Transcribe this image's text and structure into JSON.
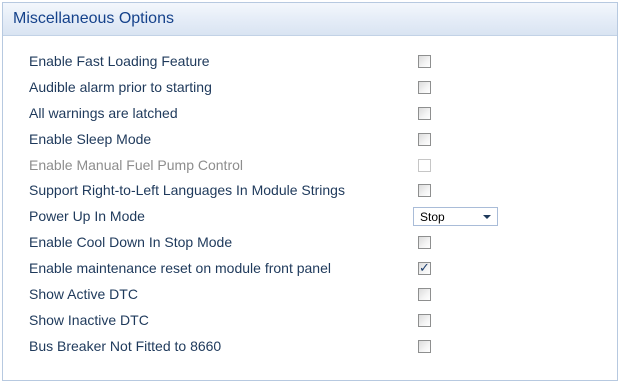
{
  "panel": {
    "title": "Miscellaneous Options"
  },
  "options": [
    {
      "label": "Enable Fast Loading Feature",
      "control": "checkbox",
      "checked": false,
      "enabled": true
    },
    {
      "label": "Audible alarm prior to starting",
      "control": "checkbox",
      "checked": false,
      "enabled": true
    },
    {
      "label": "All warnings are latched",
      "control": "checkbox",
      "checked": false,
      "enabled": true
    },
    {
      "label": "Enable Sleep Mode",
      "control": "checkbox",
      "checked": false,
      "enabled": true
    },
    {
      "label": "Enable Manual Fuel Pump Control",
      "control": "checkbox",
      "checked": false,
      "enabled": false
    },
    {
      "label": "Support Right-to-Left Languages In Module Strings",
      "control": "checkbox",
      "checked": false,
      "enabled": true
    },
    {
      "label": "Power Up In Mode",
      "control": "select",
      "value": "Stop",
      "enabled": true
    },
    {
      "label": "Enable Cool Down In Stop Mode",
      "control": "checkbox",
      "checked": false,
      "enabled": true
    },
    {
      "label": "Enable maintenance reset on module front panel",
      "control": "checkbox",
      "checked": true,
      "enabled": true
    },
    {
      "label": "Show Active DTC",
      "control": "checkbox",
      "checked": false,
      "enabled": true
    },
    {
      "label": "Show Inactive DTC",
      "control": "checkbox",
      "checked": false,
      "enabled": true
    },
    {
      "label": "Bus Breaker Not Fitted to 8660",
      "control": "checkbox",
      "checked": false,
      "enabled": true
    }
  ],
  "colors": {
    "label_text": "#1e395b",
    "disabled_text": "#8d8d8d",
    "header_text": "#15428b",
    "check_mark": "#1e3f6e"
  },
  "icons": {
    "check": "✓",
    "dropdown": "chevron-down-icon"
  }
}
